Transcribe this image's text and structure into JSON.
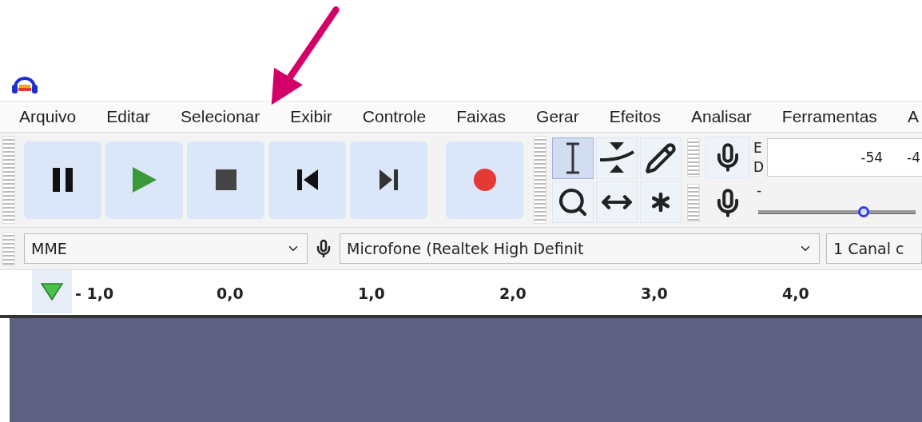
{
  "menu": [
    {
      "label": "Arquivo"
    },
    {
      "label": "Editar"
    },
    {
      "label": "Selecionar"
    },
    {
      "label": "Exibir"
    },
    {
      "label": "Controle"
    },
    {
      "label": "Faixas"
    },
    {
      "label": "Gerar"
    },
    {
      "label": "Efeitos"
    },
    {
      "label": "Analisar"
    },
    {
      "label": "Ferramentas"
    },
    {
      "label": "A"
    }
  ],
  "transport": [
    {
      "kind": "pause"
    },
    {
      "kind": "play"
    },
    {
      "kind": "stop"
    },
    {
      "kind": "skip-start"
    },
    {
      "kind": "skip-end"
    },
    {
      "kind": "record"
    }
  ],
  "tools": [
    {
      "kind": "select",
      "selected": true
    },
    {
      "kind": "envelope",
      "selected": false
    },
    {
      "kind": "draw",
      "selected": false
    },
    {
      "kind": "zoom",
      "selected": false
    },
    {
      "kind": "timeshift",
      "selected": false
    },
    {
      "kind": "multi",
      "selected": false
    }
  ],
  "meter": {
    "channels": [
      "E",
      "D"
    ],
    "scale": [
      "-54",
      "-4"
    ],
    "slider_label": "-",
    "level": 0.67
  },
  "devices": {
    "host": "MME",
    "input": "Microfone (Realtek High Definit",
    "channels": "1 Canal c"
  },
  "ruler": {
    "labels": [
      "- 1,0",
      "0,0",
      "1,0",
      "2,0",
      "3,0",
      "4,0"
    ]
  }
}
